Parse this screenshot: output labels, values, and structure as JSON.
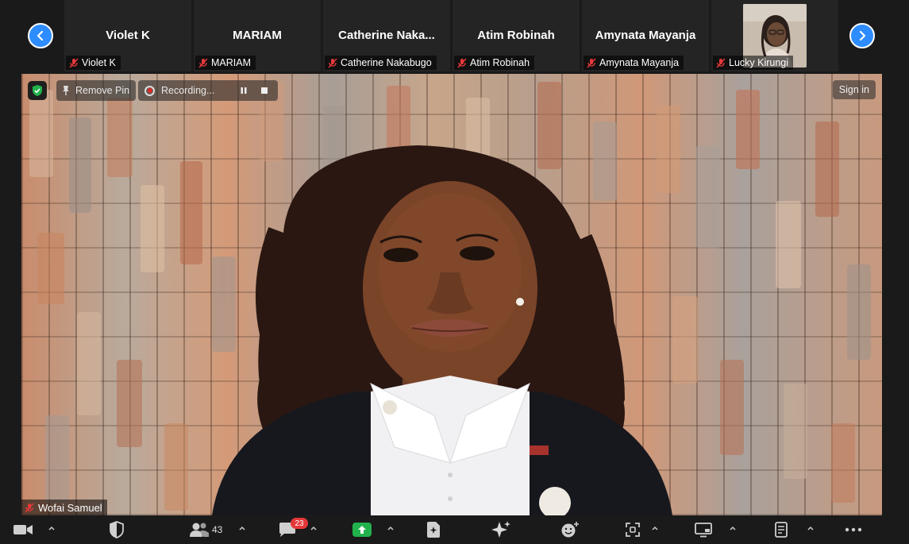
{
  "participants_strip": {
    "tiles": [
      {
        "title": "Violet K",
        "label": "Violet K",
        "muted": true
      },
      {
        "title": "MARIAM",
        "label": "MARIAM",
        "muted": true
      },
      {
        "title": "Catherine  Naka...",
        "label": "Catherine Nakabugo",
        "muted": true
      },
      {
        "title": "Atim Robinah",
        "label": "Atim Robinah",
        "muted": true
      },
      {
        "title": "Amynata Mayanja",
        "label": "Amynata Mayanja",
        "muted": true
      },
      {
        "title": "",
        "label": "Lucky Kirungi",
        "muted": true,
        "has_video": true
      }
    ],
    "prev_icon": "chevron-left-icon",
    "next_icon": "chevron-right-icon"
  },
  "main_video": {
    "remove_pin_label": "Remove Pin",
    "recording_label": "Recording...",
    "sign_in_label": "Sign in",
    "speaker_name": "Wofai Samuel",
    "speaker_muted": true
  },
  "toolbar": {
    "participants_count": "43",
    "chat_unread": "23"
  },
  "colors": {
    "accent": "#2d8cff",
    "muted_red": "#e5383b",
    "share_green": "#22b24c",
    "security_green": "#22b24c"
  }
}
